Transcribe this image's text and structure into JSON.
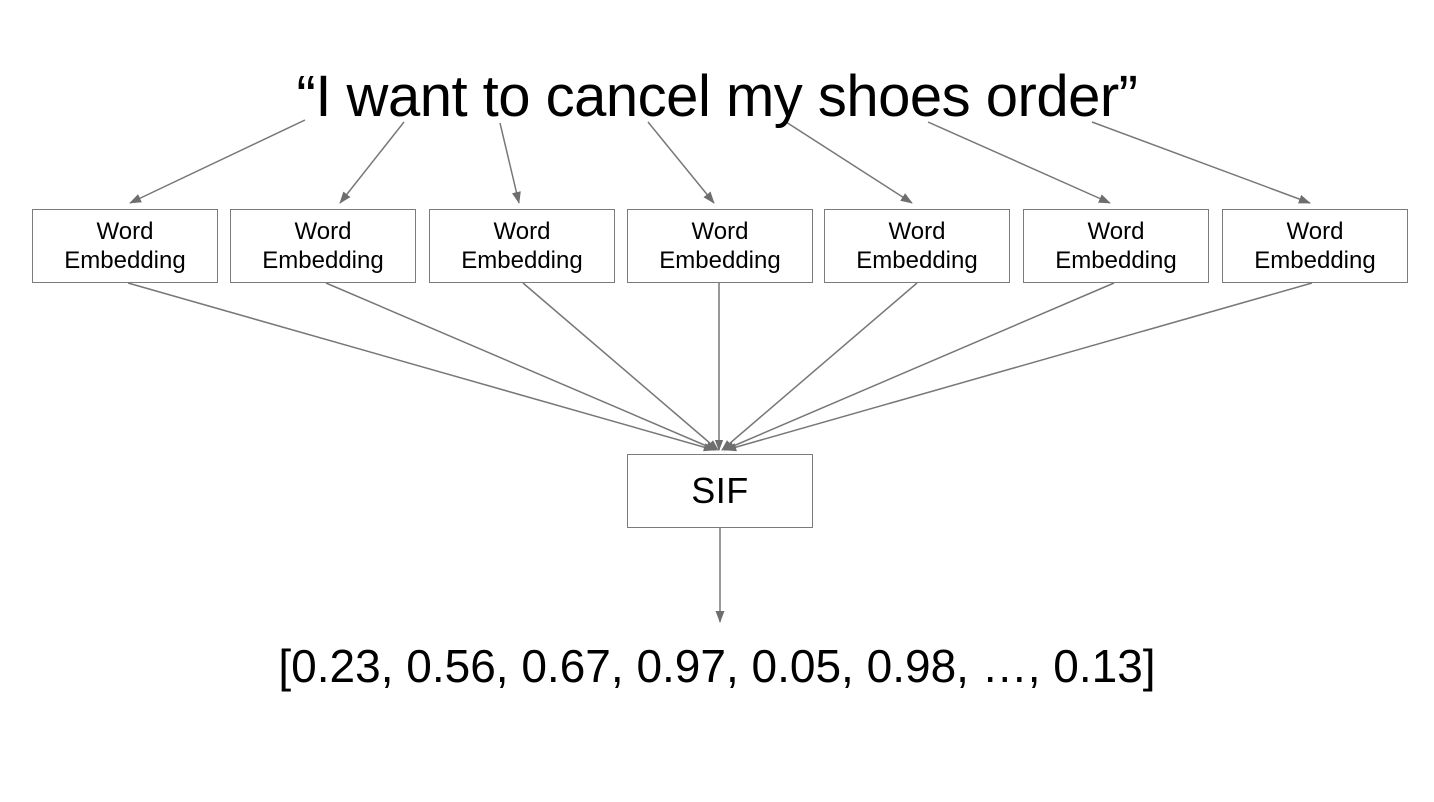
{
  "diagram": {
    "title": "“I want to cancel my shoes order”",
    "background_color": "#ffffff",
    "edge_color": "#777777",
    "box_border_color": "#7b7b7b",
    "text_color": "#000000",
    "word_embedding_nodes": [
      {
        "line1": "Word",
        "line2": "Embedding"
      },
      {
        "line1": "Word",
        "line2": "Embedding"
      },
      {
        "line1": "Word",
        "line2": "Embedding"
      },
      {
        "line1": "Word",
        "line2": "Embedding"
      },
      {
        "line1": "Word",
        "line2": "Embedding"
      },
      {
        "line1": "Word",
        "line2": "Embedding"
      },
      {
        "line1": "Word",
        "line2": "Embedding"
      }
    ],
    "aggregator": {
      "label": "SIF"
    },
    "output": {
      "vector": "[0.23, 0.56, 0.67, 0.97, 0.05, 0.98, …, 0.13]"
    }
  }
}
